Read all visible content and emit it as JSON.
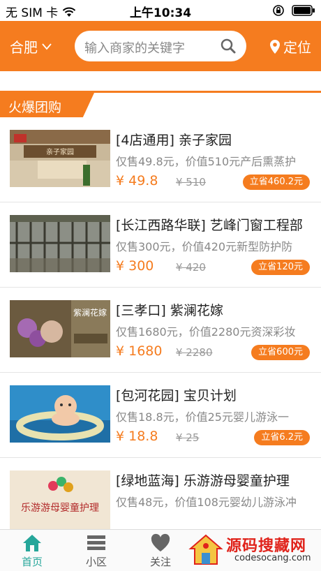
{
  "status_bar": {
    "carrier": "无 SIM 卡",
    "time": "上午10:34"
  },
  "header": {
    "city": "合肥",
    "search_placeholder": "输入商家的关键字",
    "locate_label": "定位",
    "accent_color": "#f57c1f"
  },
  "section": {
    "title": "火爆团购"
  },
  "deals": [
    {
      "title": "[4店通用] 亲子家园",
      "desc": "仅售49.8元，价值510元产后熏蒸护",
      "price": "¥ 49.8",
      "original": "¥ 510",
      "save": "立省460.2元",
      "thumb_text": "亲子家园"
    },
    {
      "title": "[长江西路华联] 艺峰门窗工程部",
      "desc": "仅售300元，价值420元新型防护防",
      "price": "¥ 300",
      "original": "¥ 420",
      "save": "立省120元"
    },
    {
      "title": "[三孝口] 紫澜花嫁",
      "desc": "仅售1680元，价值2280元资深彩妆",
      "price": "¥ 1680",
      "original": "¥ 2280",
      "save": "立省600元",
      "thumb_text": "紫澜花嫁"
    },
    {
      "title": "[包河花园] 宝贝计划",
      "desc": "仅售18.8元，价值25元婴儿游泳一",
      "price": "¥ 18.8",
      "original": "¥ 25",
      "save": "立省6.2元"
    },
    {
      "title": "[绿地蓝海] 乐游游母婴童护理",
      "desc": "仅售48元，价值108元婴幼儿游泳冲",
      "price": "",
      "original": "",
      "save": "",
      "thumb_text": "乐游游母婴童护理"
    }
  ],
  "tabs": [
    {
      "label": "首页",
      "icon": "home-icon",
      "active": true
    },
    {
      "label": "小区",
      "icon": "list-icon",
      "active": false
    },
    {
      "label": "关注",
      "icon": "heart-icon",
      "active": false
    }
  ],
  "watermark": {
    "text": "源码搜藏网",
    "url": "codesocang.com"
  }
}
